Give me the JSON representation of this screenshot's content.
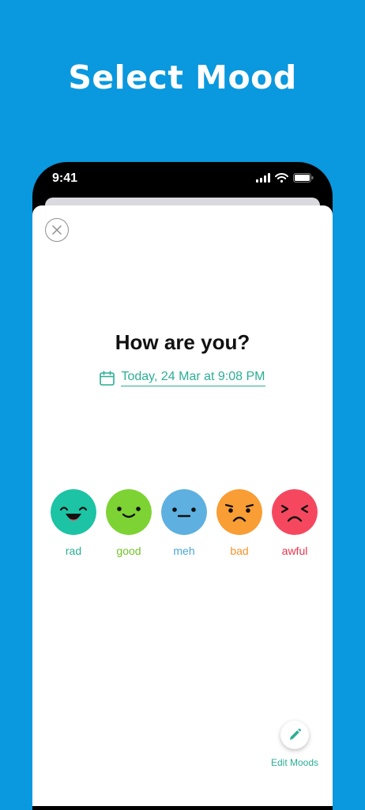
{
  "headline": "Select Mood",
  "status_bar": {
    "time": "9:41",
    "icons": [
      "signal-icon",
      "wifi-icon",
      "battery-icon"
    ]
  },
  "screen": {
    "close_icon": "close-icon",
    "title": "How are you?",
    "date": {
      "icon": "calendar-icon",
      "text": "Today, 24 Mar at 9:08 PM"
    },
    "moods": [
      {
        "label": "rad",
        "color": "#1cc3a5",
        "label_color": "#26b196"
      },
      {
        "label": "good",
        "color": "#7dd333",
        "label_color": "#72c32a"
      },
      {
        "label": "meh",
        "color": "#5eb0e0",
        "label_color": "#4aa5da"
      },
      {
        "label": "bad",
        "color": "#f99d35",
        "label_color": "#f5932a"
      },
      {
        "label": "awful",
        "color": "#f5485f",
        "label_color": "#e9354d"
      }
    ],
    "edit_moods": {
      "label": "Edit Moods",
      "icon": "pencil-icon"
    }
  },
  "colors": {
    "background": "#0a98de",
    "accent": "#2bae96"
  }
}
